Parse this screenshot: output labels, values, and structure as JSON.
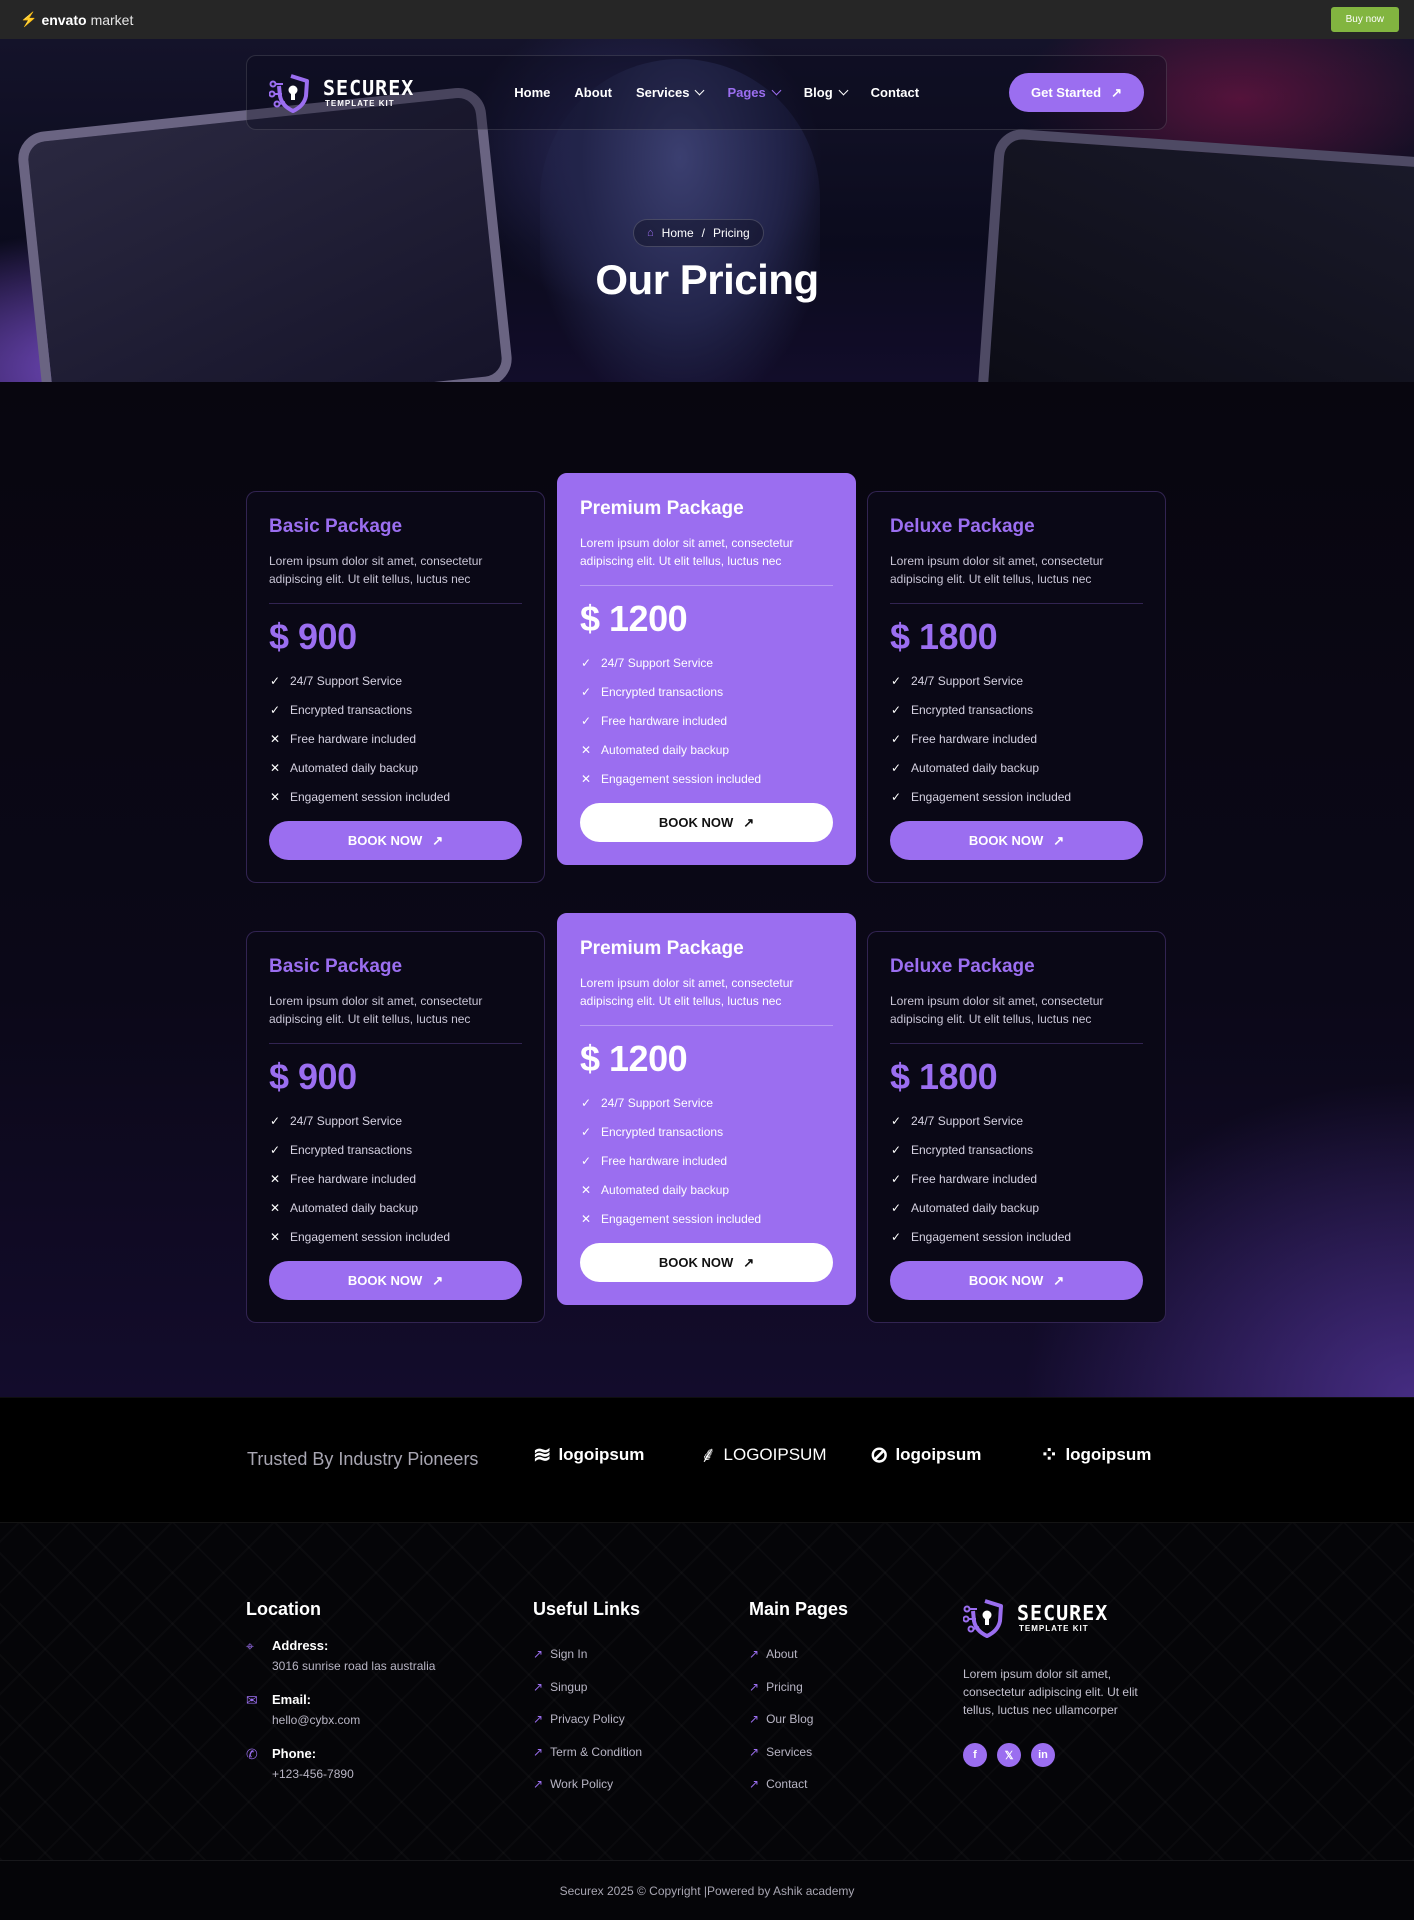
{
  "envato": {
    "logo_bold": "envato",
    "logo_rest": "market",
    "buy_label": "Buy now"
  },
  "brand": {
    "name_a": "SECURE",
    "name_b": "X",
    "sub": "TEMPLATE KIT"
  },
  "nav": {
    "items": [
      "Home",
      "About",
      "Services",
      "Pages",
      "Blog",
      "Contact"
    ],
    "cta": "Get Started"
  },
  "hero": {
    "crumb_home": "Home",
    "crumb_sep": "/",
    "crumb_current": "Pricing",
    "title": "Our Pricing"
  },
  "pricing": {
    "desc": "Lorem ipsum dolor sit amet, consectetur adipiscing elit. Ut elit tellus, luctus nec",
    "book_label": "BOOK NOW",
    "features": [
      "24/7 Support Service",
      "Encrypted transactions",
      "Free hardware included",
      "Automated daily backup",
      "Engagement session included"
    ],
    "cards": [
      {
        "name": "Basic Package",
        "price": "$ 900",
        "included": [
          true,
          true,
          false,
          false,
          false
        ]
      },
      {
        "name": "Premium Package",
        "price": "$ 1200",
        "included": [
          true,
          true,
          true,
          false,
          false
        ]
      },
      {
        "name": "Deluxe Package",
        "price": "$ 1800",
        "included": [
          true,
          true,
          true,
          true,
          true
        ]
      }
    ]
  },
  "trusted": {
    "label": "Trusted By Industry Pioneers",
    "logos": [
      "logoipsum",
      "LOGOIPSUM",
      "logoipsum",
      "logoipsum"
    ]
  },
  "footer": {
    "location_title": "Location",
    "address_label": "Address:",
    "address": "3016 sunrise road las australia",
    "email_label": "Email:",
    "email": "hello@cybx.com",
    "phone_label": "Phone:",
    "phone": "+123-456-7890",
    "useful_title": "Useful Links",
    "useful_links": [
      "Sign In",
      "Singup",
      "Privacy Policy",
      "Term & Condition",
      "Work Policy"
    ],
    "main_title": "Main Pages",
    "main_links": [
      "About",
      "Pricing",
      "Our Blog",
      "Services",
      "Contact"
    ],
    "about": "Lorem ipsum dolor sit amet, consectetur adipiscing elit. Ut elit tellus, luctus nec ullamcorper",
    "socials": [
      "facebook-icon",
      "x-icon",
      "linkedin-icon"
    ]
  },
  "copyright": "Securex 2025 © Copyright |Powered by Ashik academy",
  "colors": {
    "accent": "#9b6ef0",
    "envato_green": "#82b540",
    "background": "#06040c"
  }
}
